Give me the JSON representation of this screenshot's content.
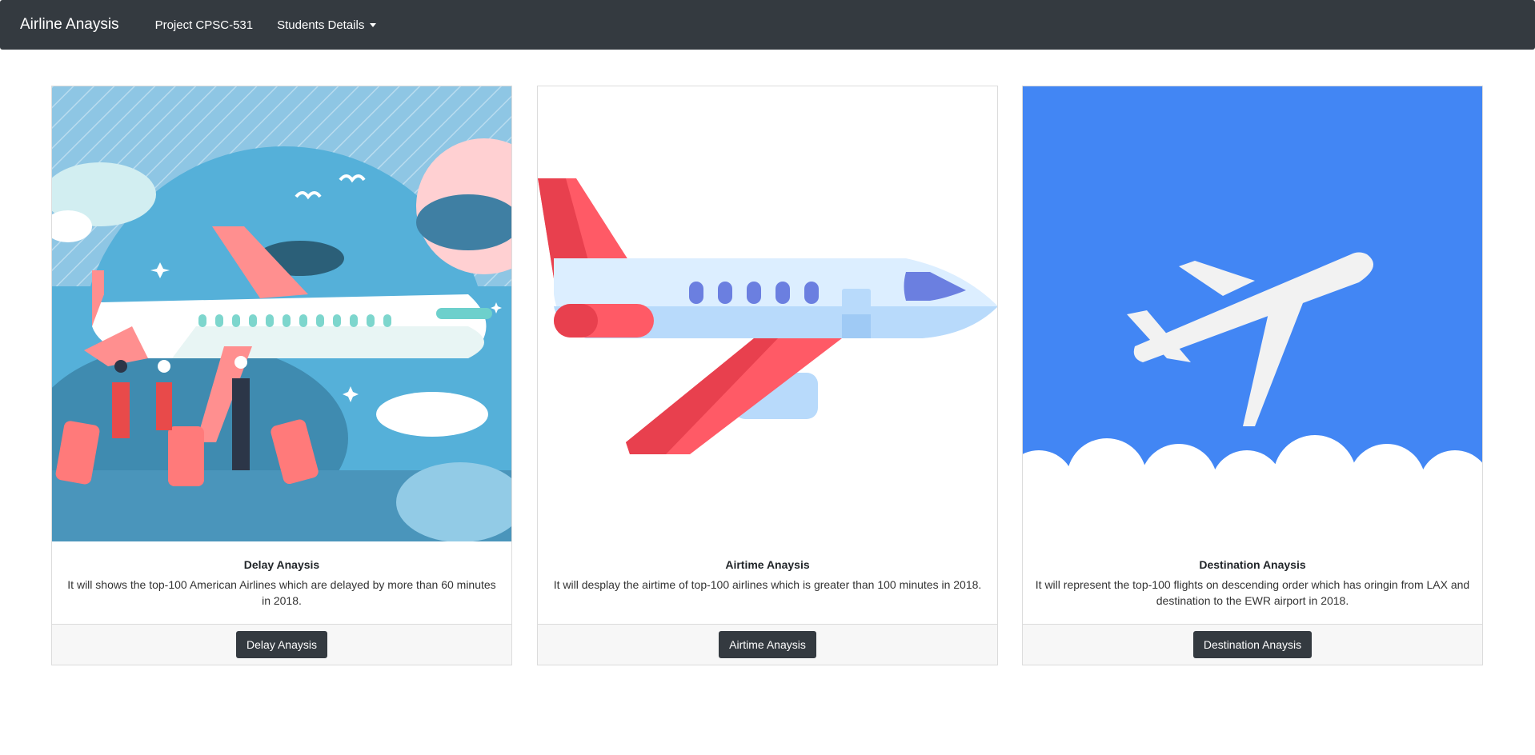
{
  "navbar": {
    "brand": "Airline Anaysis",
    "links": [
      {
        "label": "Project CPSC-531"
      },
      {
        "label": "Students Details"
      }
    ]
  },
  "cards": [
    {
      "title": "Delay Anaysis",
      "text": "It will shows the top-100 American Airlines which are delayed by more than 60 minutes in 2018.",
      "button": "Delay Anaysis",
      "image": "airport-travelers-illustration"
    },
    {
      "title": "Airtime Anaysis",
      "text": "It will desplay the airtime of top-100 airlines which is greater than 100 minutes in 2018.",
      "button": "Airtime Anaysis",
      "image": "airplane-illustration"
    },
    {
      "title": "Destination Anaysis",
      "text": "It will represent the top-100 flights on descending order which has oringin from LAX and destination to the EWR airport in 2018.",
      "button": "Destination Anaysis",
      "image": "airplane-in-sky-illustration"
    }
  ]
}
